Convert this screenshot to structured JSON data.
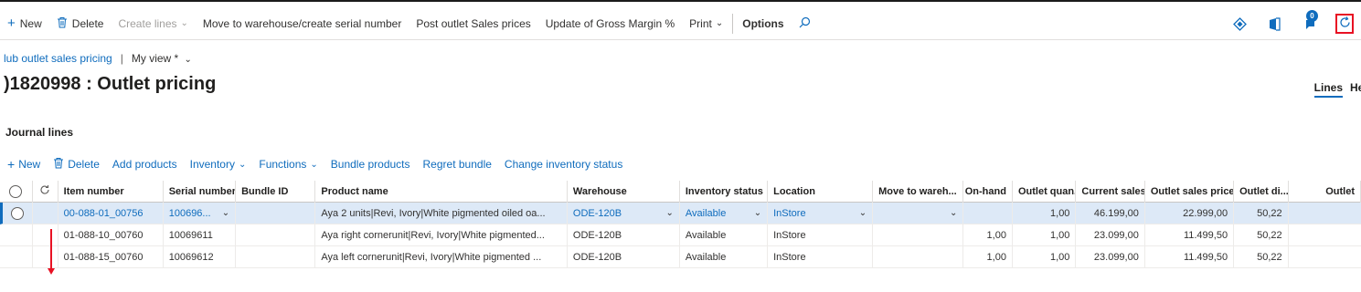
{
  "toolbar": {
    "new_label": "New",
    "delete_label": "Delete",
    "create_lines_label": "Create lines",
    "move_label": "Move to warehouse/create serial number",
    "post_label": "Post outlet Sales prices",
    "update_label": "Update of Gross Margin %",
    "print_label": "Print",
    "options_label": "Options",
    "notification_count": "0"
  },
  "breadcrumb": {
    "link": "lub outlet sales pricing",
    "view": "My view *"
  },
  "page": {
    "title": ")1820998 : Outlet pricing",
    "tab_lines": "Lines",
    "tab_cut": "He"
  },
  "section": {
    "title": "Journal lines"
  },
  "actions": {
    "new": "New",
    "delete": "Delete",
    "add_products": "Add products",
    "inventory": "Inventory",
    "functions": "Functions",
    "bundle_products": "Bundle products",
    "regret_bundle": "Regret bundle",
    "change_inventory_status": "Change inventory status"
  },
  "table": {
    "headers": {
      "item_number": "Item number",
      "serial_number": "Serial number",
      "bundle_id": "Bundle ID",
      "product_name": "Product name",
      "warehouse": "Warehouse",
      "inventory_status": "Inventory status",
      "location": "Location",
      "move_to_warehouse": "Move to wareh...",
      "on_hand": "On-hand",
      "outlet_quantity": "Outlet quan...",
      "current_sales": "Current sales...",
      "outlet_sales_price": "Outlet sales price",
      "outlet_discount": "Outlet di...",
      "outlet": "Outlet"
    },
    "rows": [
      {
        "item_number": "00-088-01_00756",
        "serial_number": "100696...",
        "bundle_id": "",
        "product_name": "Aya 2 units|Revi, Ivory|White pigmented oiled oa...",
        "warehouse": "ODE-120B",
        "inventory_status": "Available",
        "location": "InStore",
        "move_to_warehouse": "",
        "on_hand": "",
        "outlet_quantity": "1,00",
        "current_sales": "46.199,00",
        "outlet_sales_price": "22.999,00",
        "outlet_discount": "50,22",
        "outlet": ""
      },
      {
        "item_number": "01-088-10_00760",
        "serial_number": "10069611",
        "bundle_id": "",
        "product_name": "Aya right cornerunit|Revi, Ivory|White pigmented...",
        "warehouse": "ODE-120B",
        "inventory_status": "Available",
        "location": "InStore",
        "move_to_warehouse": "",
        "on_hand": "1,00",
        "outlet_quantity": "1,00",
        "current_sales": "23.099,00",
        "outlet_sales_price": "11.499,50",
        "outlet_discount": "50,22",
        "outlet": ""
      },
      {
        "item_number": "01-088-15_00760",
        "serial_number": "10069612",
        "bundle_id": "",
        "product_name": "Aya left cornerunit|Revi, Ivory|White pigmented ...",
        "warehouse": "ODE-120B",
        "inventory_status": "Available",
        "location": "InStore",
        "move_to_warehouse": "",
        "on_hand": "1,00",
        "outlet_quantity": "1,00",
        "current_sales": "23.099,00",
        "outlet_sales_price": "11.499,50",
        "outlet_discount": "50,22",
        "outlet": ""
      }
    ]
  },
  "colors": {
    "accent": "#0f6cbd",
    "highlight": "#e81123",
    "selected_row": "#dde9f7"
  }
}
